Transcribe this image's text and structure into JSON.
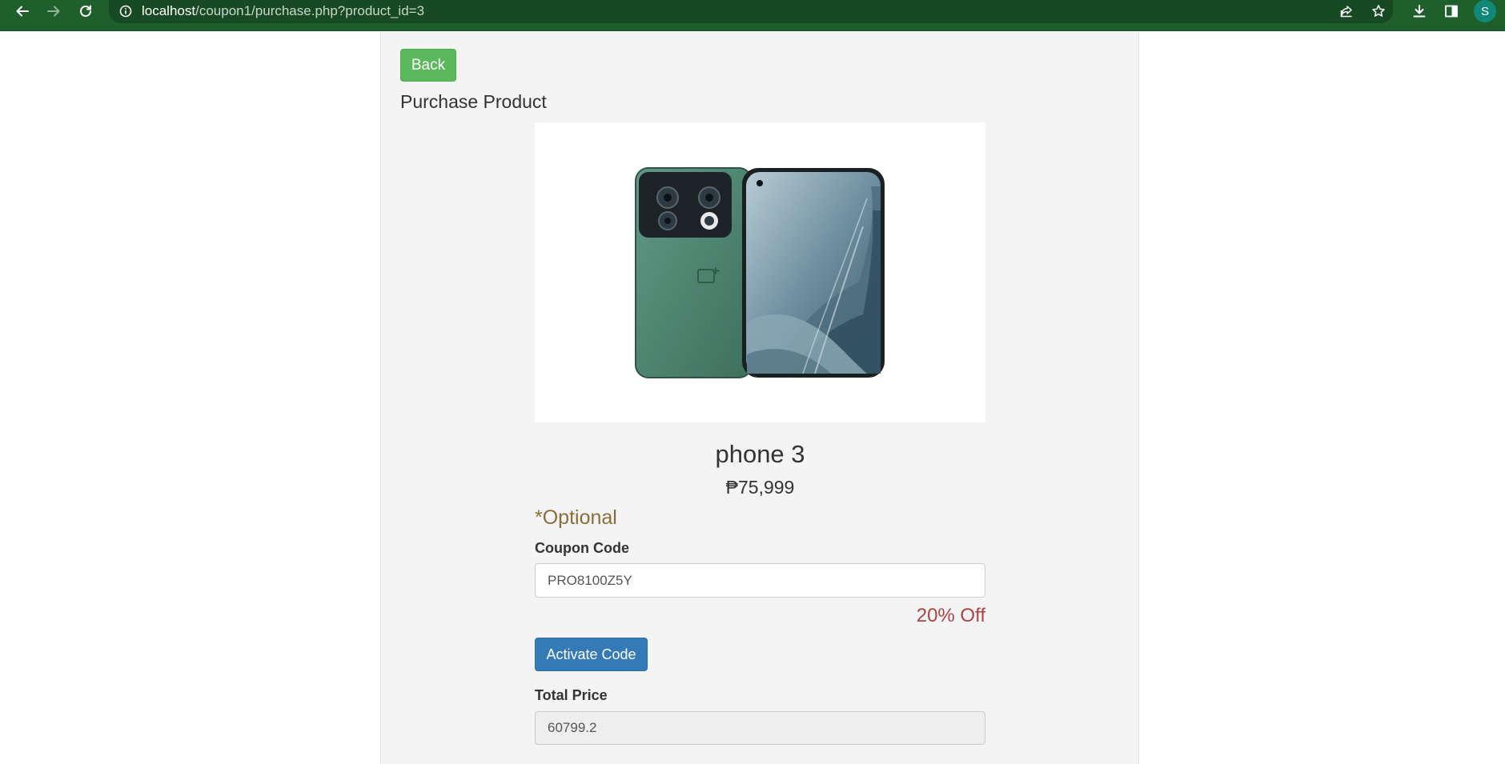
{
  "browser": {
    "url_host": "localhost",
    "url_path": "/coupon1/purchase.php?product_id=3",
    "profile_initial": "S",
    "icons": {
      "back": "arrow-left-icon",
      "forward": "arrow-right-icon",
      "reload": "reload-icon",
      "site_info": "info-icon",
      "share": "share-icon",
      "bookmark": "star-icon",
      "download": "download-icon",
      "side_panel": "side-panel-icon"
    }
  },
  "page": {
    "back_label": "Back",
    "heading": "Purchase Product",
    "product": {
      "name": "phone 3",
      "price": "₱75,999",
      "image": "smartphone-product-image"
    },
    "optional_note": "*Optional",
    "coupon": {
      "label": "Coupon Code",
      "value": "PRO8100Z5Y",
      "discount": "20% Off",
      "activate_label": "Activate Code"
    },
    "total": {
      "label": "Total Price",
      "value": "60799.2"
    }
  },
  "colors": {
    "toolbar": "#1f5f2c",
    "back_button": "#5cb85c",
    "activate_button": "#337ab7",
    "optional_text": "#8a6d3b",
    "discount_text": "#a94442",
    "panel": "#f4f4f4"
  }
}
